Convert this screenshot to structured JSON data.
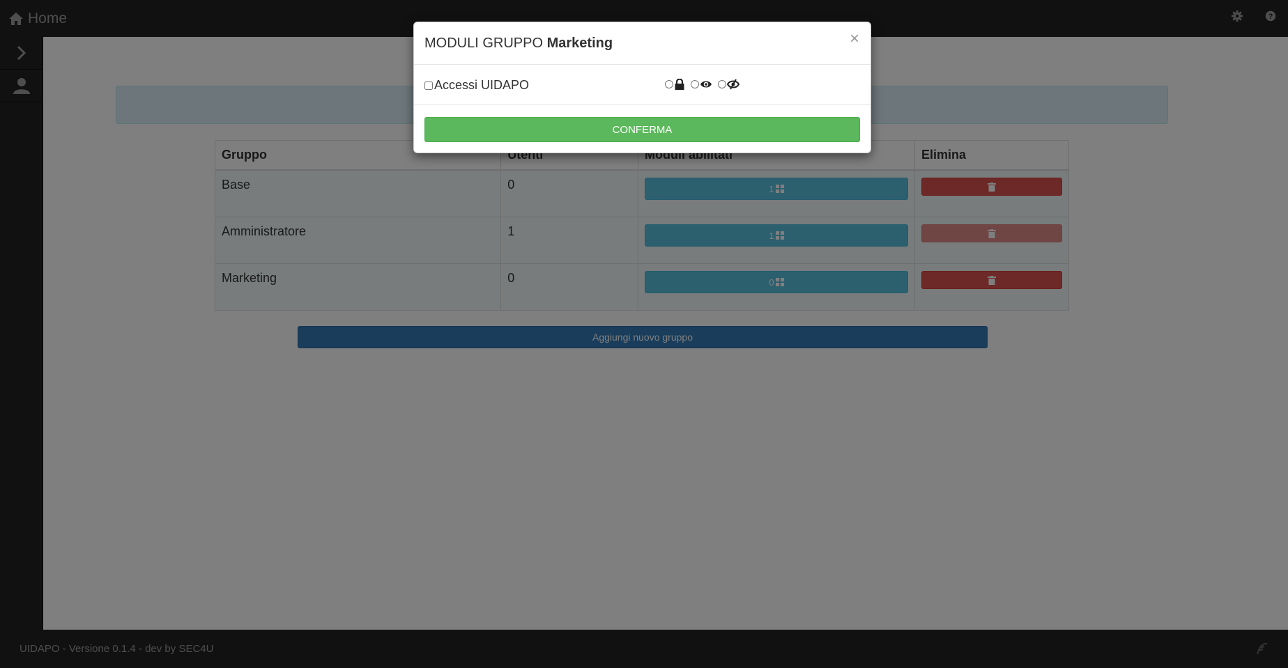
{
  "navbar": {
    "home_label": "Home",
    "icons": [
      "home-icon",
      "gear-icon",
      "question-circle-icon"
    ]
  },
  "sidebar": {
    "items": [
      {
        "icon": "chevron-right-icon"
      },
      {
        "icon": "user-icon"
      }
    ]
  },
  "table": {
    "headers": [
      "Gruppo",
      "Utenti",
      "Moduli abilitati",
      "Elimina"
    ],
    "rows": [
      {
        "gruppo": "Base",
        "utenti": "0",
        "moduli": "1"
      },
      {
        "gruppo": "Amministratore",
        "utenti": "1",
        "moduli": "1"
      },
      {
        "gruppo": "Marketing",
        "utenti": "0",
        "moduli": "0"
      }
    ]
  },
  "add_button_label": "Aggiungi nuovo gruppo",
  "footer": {
    "text": "UIDAPO - Versione 0.1.4 - dev by SEC4U"
  },
  "modal": {
    "title_prefix": "MODULI GRUPPO",
    "title_group": "Marketing",
    "close_symbol": "×",
    "module_label": "Accessi UIDAPO",
    "permission_icons": [
      "lock-icon",
      "eye-icon",
      "eye-slash-icon"
    ],
    "confirm_label": "CONFERMA"
  },
  "colors": {
    "navbar_bg": "#222222",
    "info_button": "#5bc0de",
    "danger_button": "#d9534f",
    "primary_button": "#337ab7",
    "success_button": "#5cb85c"
  }
}
